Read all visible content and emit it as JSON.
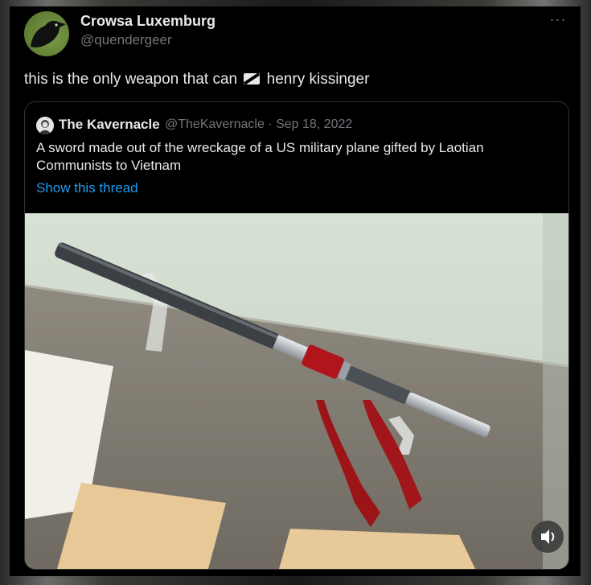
{
  "author": {
    "display_name": "Crowsa Luxemburg",
    "handle": "@quendergeer",
    "avatar_icon": "crow-avatar-icon"
  },
  "more_label": "···",
  "tweet": {
    "text_before": "this is the only weapon that can",
    "text_after": "henry kissinger",
    "emoji_icon": "censored-emoji-icon"
  },
  "quote": {
    "author_name": "The Kavernacle",
    "meta": "@TheKavernacle · Sep 18, 2022",
    "text": "A sword made out of the wreckage of a US military plane gifted by Laotian Communists to Vietnam",
    "show_thread": "Show this thread"
  },
  "media": {
    "image_icon": "sword-photo",
    "audio_icon": "speaker-icon"
  }
}
